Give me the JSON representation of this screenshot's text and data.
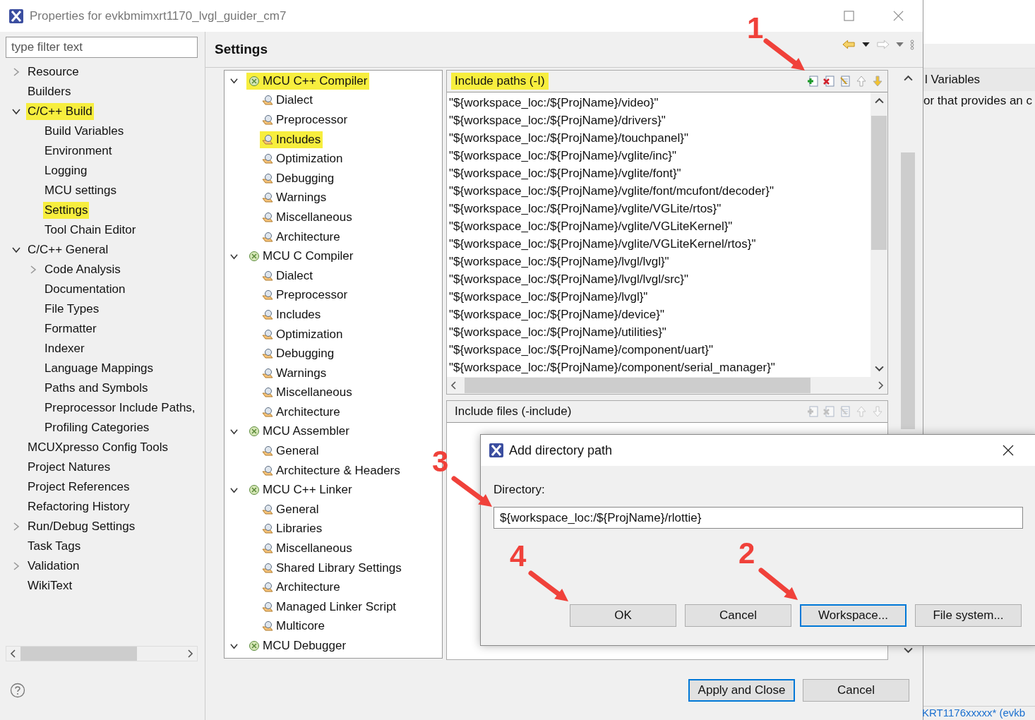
{
  "window": {
    "title": "Properties for evkbmimxrt1170_lvgl_guider_cm7"
  },
  "filter": {
    "placeholder": "type filter text"
  },
  "nav": {
    "items": [
      {
        "label": "Resource",
        "expanded": false,
        "highlighted": false
      },
      {
        "label": "Builders",
        "highlighted": false
      },
      {
        "label": "C/C++ Build",
        "expanded": true,
        "highlighted": true,
        "children": [
          {
            "label": "Build Variables",
            "highlighted": false
          },
          {
            "label": "Environment",
            "highlighted": false
          },
          {
            "label": "Logging",
            "highlighted": false
          },
          {
            "label": "MCU settings",
            "highlighted": false
          },
          {
            "label": "Settings",
            "highlighted": true
          },
          {
            "label": "Tool Chain Editor",
            "highlighted": false
          }
        ]
      },
      {
        "label": "C/C++ General",
        "expanded": true,
        "highlighted": false,
        "children": [
          {
            "label": "Code Analysis",
            "expanded": false,
            "highlighted": false
          },
          {
            "label": "Documentation",
            "highlighted": false
          },
          {
            "label": "File Types",
            "highlighted": false
          },
          {
            "label": "Formatter",
            "highlighted": false
          },
          {
            "label": "Indexer",
            "highlighted": false
          },
          {
            "label": "Language Mappings",
            "highlighted": false
          },
          {
            "label": "Paths and Symbols",
            "highlighted": false
          },
          {
            "label": "Preprocessor Include Paths,",
            "highlighted": false
          },
          {
            "label": "Profiling Categories",
            "highlighted": false
          }
        ]
      },
      {
        "label": "MCUXpresso Config Tools",
        "highlighted": false
      },
      {
        "label": "Project Natures",
        "highlighted": false
      },
      {
        "label": "Project References",
        "highlighted": false
      },
      {
        "label": "Refactoring History",
        "highlighted": false
      },
      {
        "label": "Run/Debug Settings",
        "expanded": false,
        "highlighted": false
      },
      {
        "label": "Task Tags",
        "highlighted": false
      },
      {
        "label": "Validation",
        "expanded": false,
        "highlighted": false
      },
      {
        "label": "WikiText",
        "highlighted": false
      }
    ]
  },
  "settings": {
    "title": "Settings",
    "tools": [
      {
        "label": "MCU C++ Compiler",
        "expanded": true,
        "highlighted": true,
        "children": [
          {
            "label": "Dialect",
            "highlighted": false
          },
          {
            "label": "Preprocessor",
            "highlighted": false
          },
          {
            "label": "Includes",
            "highlighted": true
          },
          {
            "label": "Optimization",
            "highlighted": false
          },
          {
            "label": "Debugging",
            "highlighted": false
          },
          {
            "label": "Warnings",
            "highlighted": false
          },
          {
            "label": "Miscellaneous",
            "highlighted": false
          },
          {
            "label": "Architecture",
            "highlighted": false
          }
        ]
      },
      {
        "label": "MCU C Compiler",
        "expanded": true,
        "highlighted": false,
        "children": [
          {
            "label": "Dialect",
            "highlighted": false
          },
          {
            "label": "Preprocessor",
            "highlighted": false
          },
          {
            "label": "Includes",
            "highlighted": false
          },
          {
            "label": "Optimization",
            "highlighted": false
          },
          {
            "label": "Debugging",
            "highlighted": false
          },
          {
            "label": "Warnings",
            "highlighted": false
          },
          {
            "label": "Miscellaneous",
            "highlighted": false
          },
          {
            "label": "Architecture",
            "highlighted": false
          }
        ]
      },
      {
        "label": "MCU Assembler",
        "expanded": true,
        "highlighted": false,
        "children": [
          {
            "label": "General",
            "highlighted": false
          },
          {
            "label": "Architecture & Headers",
            "highlighted": false
          }
        ]
      },
      {
        "label": "MCU C++ Linker",
        "expanded": true,
        "highlighted": false,
        "children": [
          {
            "label": "General",
            "highlighted": false
          },
          {
            "label": "Libraries",
            "highlighted": false
          },
          {
            "label": "Miscellaneous",
            "highlighted": false
          },
          {
            "label": "Shared Library Settings",
            "highlighted": false
          },
          {
            "label": "Architecture",
            "highlighted": false
          },
          {
            "label": "Managed Linker Script",
            "highlighted": false
          },
          {
            "label": "Multicore",
            "highlighted": false
          }
        ]
      },
      {
        "label": "MCU Debugger",
        "expanded": true,
        "highlighted": false
      }
    ],
    "include_paths": {
      "title": "Include paths (-I)",
      "highlighted": true,
      "tools_enabled": true,
      "paths": [
        "\"${workspace_loc:/${ProjName}/video}\"",
        "\"${workspace_loc:/${ProjName}/drivers}\"",
        "\"${workspace_loc:/${ProjName}/touchpanel}\"",
        "\"${workspace_loc:/${ProjName}/vglite/inc}\"",
        "\"${workspace_loc:/${ProjName}/vglite/font}\"",
        "\"${workspace_loc:/${ProjName}/vglite/font/mcufont/decoder}\"",
        "\"${workspace_loc:/${ProjName}/vglite/VGLite/rtos}\"",
        "\"${workspace_loc:/${ProjName}/vglite/VGLiteKernel}\"",
        "\"${workspace_loc:/${ProjName}/vglite/VGLiteKernel/rtos}\"",
        "\"${workspace_loc:/${ProjName}/lvgl/lvgl}\"",
        "\"${workspace_loc:/${ProjName}/lvgl/lvgl/src}\"",
        "\"${workspace_loc:/${ProjName}/lvgl}\"",
        "\"${workspace_loc:/${ProjName}/device}\"",
        "\"${workspace_loc:/${ProjName}/utilities}\"",
        "\"${workspace_loc:/${ProjName}/component/uart}\"",
        "\"${workspace_loc:/${ProjName}/component/serial_manager}\""
      ]
    },
    "include_files": {
      "title": "Include files (-include)",
      "highlighted": false,
      "tools_enabled": false
    }
  },
  "footer": {
    "buttons": [
      {
        "label": "Apply and Close",
        "default": true
      },
      {
        "label": "Cancel",
        "default": false
      }
    ]
  },
  "background_window": {
    "heading": "l Variables",
    "text": "or that provides an c",
    "link": "KRT1176xxxxx* (evkb"
  },
  "dialog": {
    "title": "Add directory path",
    "label": "Directory:",
    "value": "${workspace_loc:/${ProjName}/rlottie}",
    "buttons": [
      {
        "label": "OK",
        "default": false
      },
      {
        "label": "Cancel",
        "default": false
      },
      {
        "label": "Workspace...",
        "default": true
      },
      {
        "label": "File system...",
        "default": false
      }
    ]
  },
  "annotations": [
    {
      "number": "1"
    },
    {
      "number": "2"
    },
    {
      "number": "3"
    },
    {
      "number": "4"
    }
  ]
}
